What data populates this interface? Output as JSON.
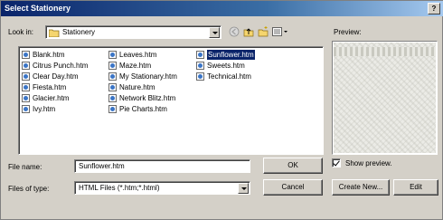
{
  "window": {
    "title": "Select Stationery",
    "help_label": "?"
  },
  "lookin": {
    "label": "Look in:",
    "value": "Stationery"
  },
  "toolbar": {
    "icons": [
      "back-icon",
      "up-folder-icon",
      "new-folder-icon",
      "views-menu-icon"
    ]
  },
  "files": [
    {
      "name": "Blank.htm",
      "selected": false
    },
    {
      "name": "Citrus Punch.htm",
      "selected": false
    },
    {
      "name": "Clear Day.htm",
      "selected": false
    },
    {
      "name": "Fiesta.htm",
      "selected": false
    },
    {
      "name": "Glacier.htm",
      "selected": false
    },
    {
      "name": "Ivy.htm",
      "selected": false
    },
    {
      "name": "Leaves.htm",
      "selected": false
    },
    {
      "name": "Maze.htm",
      "selected": false
    },
    {
      "name": "My Stationary.htm",
      "selected": false
    },
    {
      "name": "Nature.htm",
      "selected": false
    },
    {
      "name": "Network Blitz.htm",
      "selected": false
    },
    {
      "name": "Pie Charts.htm",
      "selected": false
    },
    {
      "name": "Sunflower.htm",
      "selected": true
    },
    {
      "name": "Sweets.htm",
      "selected": false
    },
    {
      "name": "Technical.htm",
      "selected": false
    }
  ],
  "filename": {
    "label": "File name:",
    "value": "Sunflower.htm"
  },
  "filetype": {
    "label": "Files of type:",
    "value": "HTML Files (*.htm;*.html)"
  },
  "buttons": {
    "ok": "OK",
    "cancel": "Cancel",
    "create_new": "Create New...",
    "edit": "Edit"
  },
  "preview": {
    "label": "Preview:",
    "show_label": "Show preview.",
    "show_checked": true
  },
  "colors": {
    "titlebar": "#0a246a",
    "selection": "#0a246a",
    "face": "#d4d0c8"
  }
}
